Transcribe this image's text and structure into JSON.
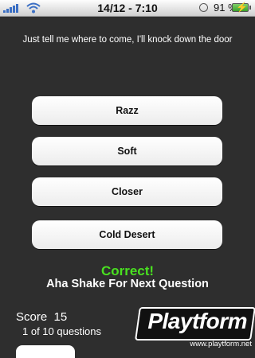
{
  "statusbar": {
    "time": "14/12 - 7:10",
    "battery_percent": "91 %"
  },
  "lyric": "Just tell me where to come, I'll knock down the door",
  "answers": [
    {
      "label": "Razz"
    },
    {
      "label": "Soft"
    },
    {
      "label": "Closer"
    },
    {
      "label": "Cold Desert"
    }
  ],
  "result": {
    "status": "Correct!",
    "message": "Aha Shake For Next Question"
  },
  "score": {
    "label": "Score",
    "value": "15",
    "progress": "1 of 10 questions"
  },
  "watermark": {
    "brand": "Playtform",
    "url": "www.playtform.net"
  },
  "colors": {
    "background": "#2e2e2e",
    "correct": "#49e020"
  },
  "icons": [
    "signal-icon",
    "wifi-icon",
    "clock-icon",
    "battery-icon",
    "charging-icon"
  ]
}
